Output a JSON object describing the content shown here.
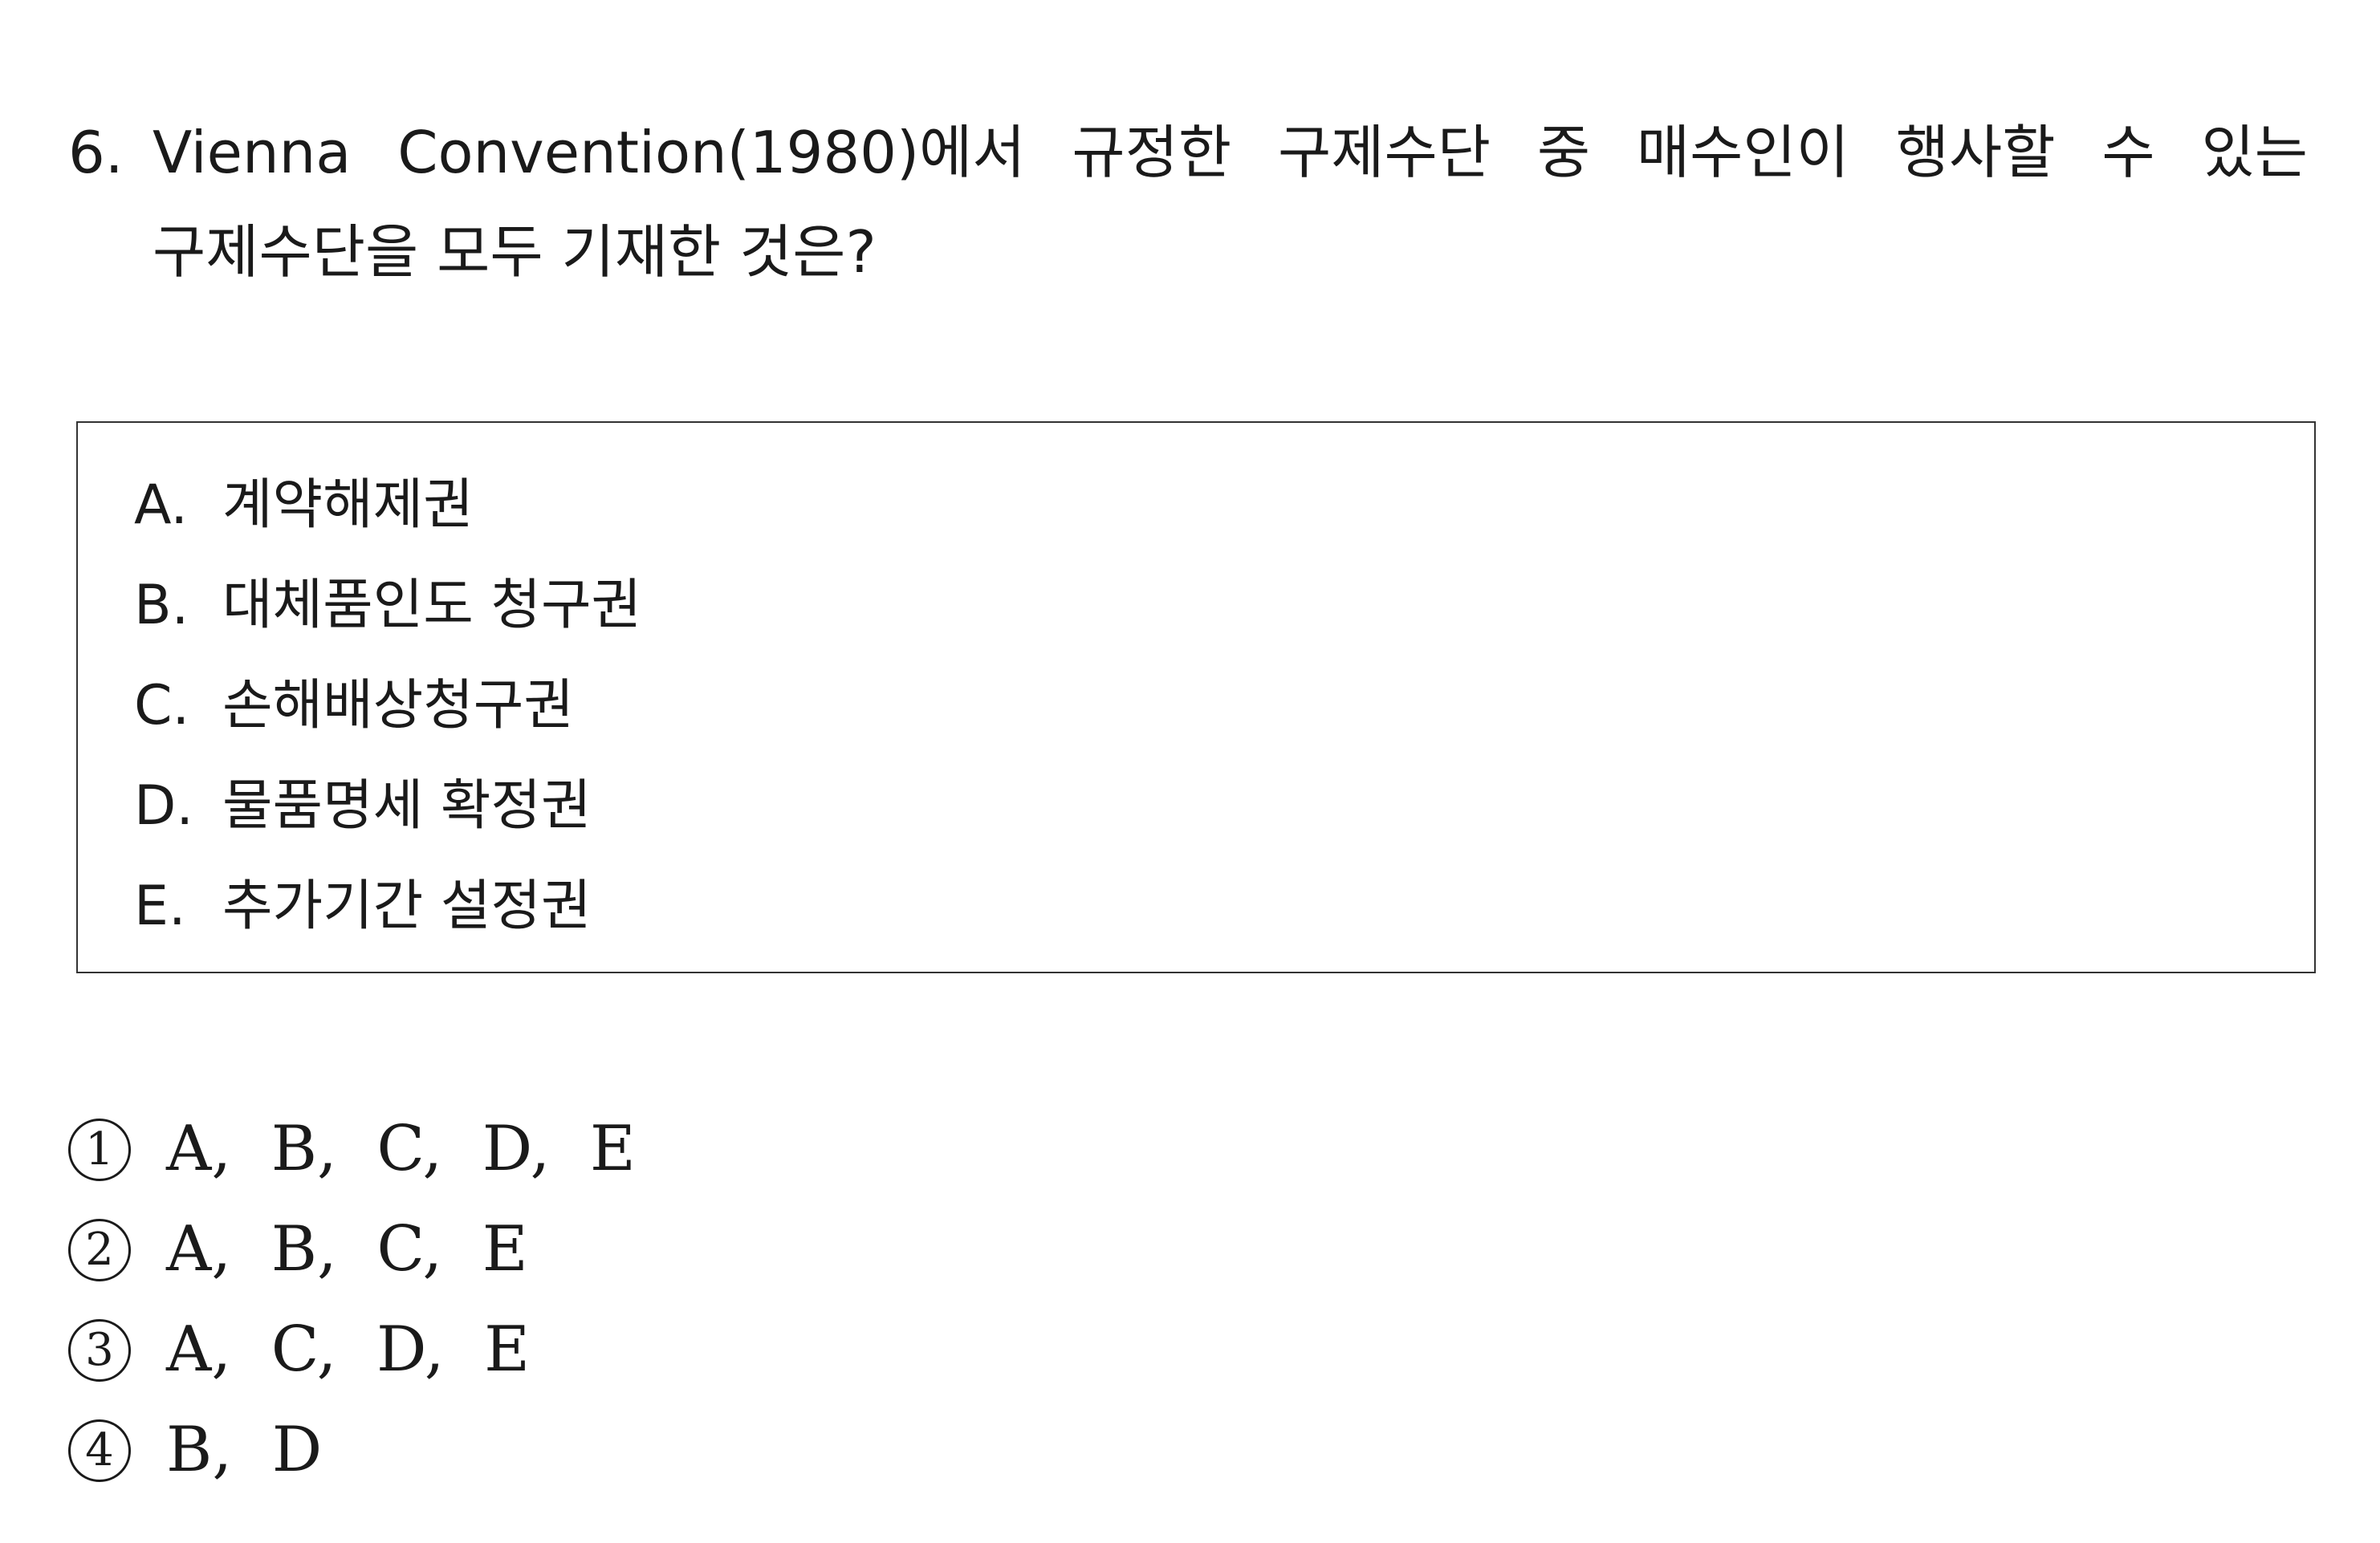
{
  "question": {
    "number": "6.",
    "line1_words": [
      "Vienna",
      "Convention(1980)에서",
      "규정한",
      "구제수단",
      "중",
      "매수인이",
      "행사할",
      "수",
      "있는"
    ],
    "line2": "구제수단을  모두  기재한  것은?"
  },
  "box": {
    "items": [
      {
        "letter": "A.",
        "text": "계약해제권"
      },
      {
        "letter": "B.",
        "text": "대체품인도 청구권"
      },
      {
        "letter": "C.",
        "text": "손해배상청구권"
      },
      {
        "letter": "D.",
        "text": "물품명세 확정권"
      },
      {
        "letter": "E.",
        "text": "추가기간 설정권"
      }
    ]
  },
  "answers": [
    {
      "marker": "1",
      "text": "A,  B,  C,  D,  E"
    },
    {
      "marker": "2",
      "text": "A,  B,  C,  E"
    },
    {
      "marker": "3",
      "text": "A,  C,  D,  E"
    },
    {
      "marker": "4",
      "text": "B,  D"
    }
  ]
}
